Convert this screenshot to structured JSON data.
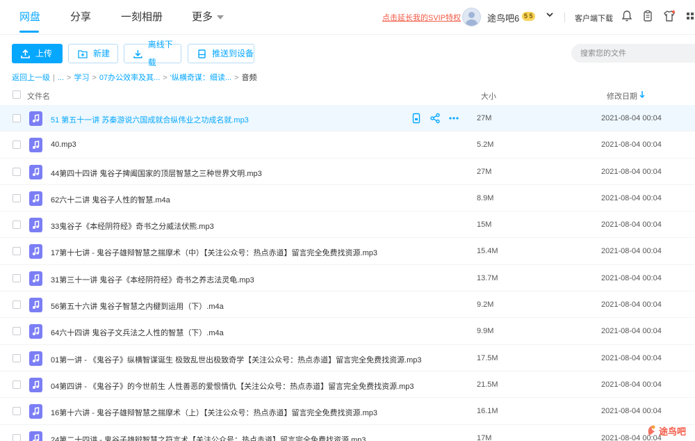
{
  "nav": {
    "tabs": [
      {
        "label": "网盘"
      },
      {
        "label": "分享"
      },
      {
        "label": "一刻相册"
      },
      {
        "label": "更多"
      }
    ],
    "svip_link": "点击延长我的SVIP特权",
    "username": "途鸟吧6",
    "badge": "5 5",
    "client_download": "客户端下载"
  },
  "toolbar": {
    "upload": "上传",
    "new": "新建",
    "offline": "离线下载",
    "push": "推送到设备",
    "search_placeholder": "搜索您的文件"
  },
  "breadcrumb": {
    "back": "返回上一级",
    "ellipsis": "...",
    "items": [
      "学习",
      "07办公效率及其...",
      "'纵横奇谋：细读...",
      "音频"
    ]
  },
  "table": {
    "col_name": "文件名",
    "col_size": "大小",
    "col_date": "修改日期",
    "rows": [
      {
        "name": "51 第五十一讲 苏秦游说六国成就合纵伟业之功成名就.mp3",
        "size": "27M",
        "date": "2021-08-04 00:04"
      },
      {
        "name": "40.mp3",
        "size": "5.2M",
        "date": "2021-08-04 00:04"
      },
      {
        "name": "44第四十四讲 鬼谷子捭阖国家的顶层智慧之三种世界文明.mp3",
        "size": "27M",
        "date": "2021-08-04 00:04"
      },
      {
        "name": "62六十二讲 鬼谷子人性的智慧.m4a",
        "size": "8.9M",
        "date": "2021-08-04 00:04"
      },
      {
        "name": "33鬼谷子《本经阴符经》奇书之分威法伏熊.mp3",
        "size": "15M",
        "date": "2021-08-04 00:04"
      },
      {
        "name": "17第十七讲 - 鬼谷子雄辩智慧之揣摩术（中）【关注公众号：热点赤道】留言完全免费找资源.mp3",
        "size": "15.4M",
        "date": "2021-08-04 00:04"
      },
      {
        "name": "31第三十一讲 鬼谷子《本经阴符经》奇书之养志法灵龟.mp3",
        "size": "13.7M",
        "date": "2021-08-04 00:04"
      },
      {
        "name": "56第五十六讲 鬼谷子智慧之内楗到运用（下）.m4a",
        "size": "9.2M",
        "date": "2021-08-04 00:04"
      },
      {
        "name": "64六十四讲 鬼谷子文兵法之人性的智慧（下）.m4a",
        "size": "9.9M",
        "date": "2021-08-04 00:04"
      },
      {
        "name": "01第一讲 - 《鬼谷子》纵横智谋诞生 极致乱世出极致奇学【关注公众号：热点赤道】留言完全免费找资源.mp3",
        "size": "17.5M",
        "date": "2021-08-04 00:04"
      },
      {
        "name": "04第四讲 - 《鬼谷子》的今世前生 人性善恶的爱恨情仇【关注公众号：热点赤道】留言完全免费找资源.mp3",
        "size": "21.5M",
        "date": "2021-08-04 00:04"
      },
      {
        "name": "16第十六讲 - 鬼谷子雄辩智慧之揣摩术（上）【关注公众号：热点赤道】留言完全免费找资源.mp3",
        "size": "16.1M",
        "date": "2021-08-04 00:04"
      },
      {
        "name": "24第二十四讲 - 鬼谷子雄辩智慧之符言术【关注公众号：热点赤道】留言完全免费找资源.mp3",
        "size": "17M",
        "date": "2021-08-04 00:04"
      }
    ]
  },
  "watermark_text": "途鸟吧",
  "colors": {
    "accent": "#06a7ff",
    "file_icon": "#7b7ef4",
    "svip": "#f25a46",
    "hover_row": "#eef8fe"
  }
}
